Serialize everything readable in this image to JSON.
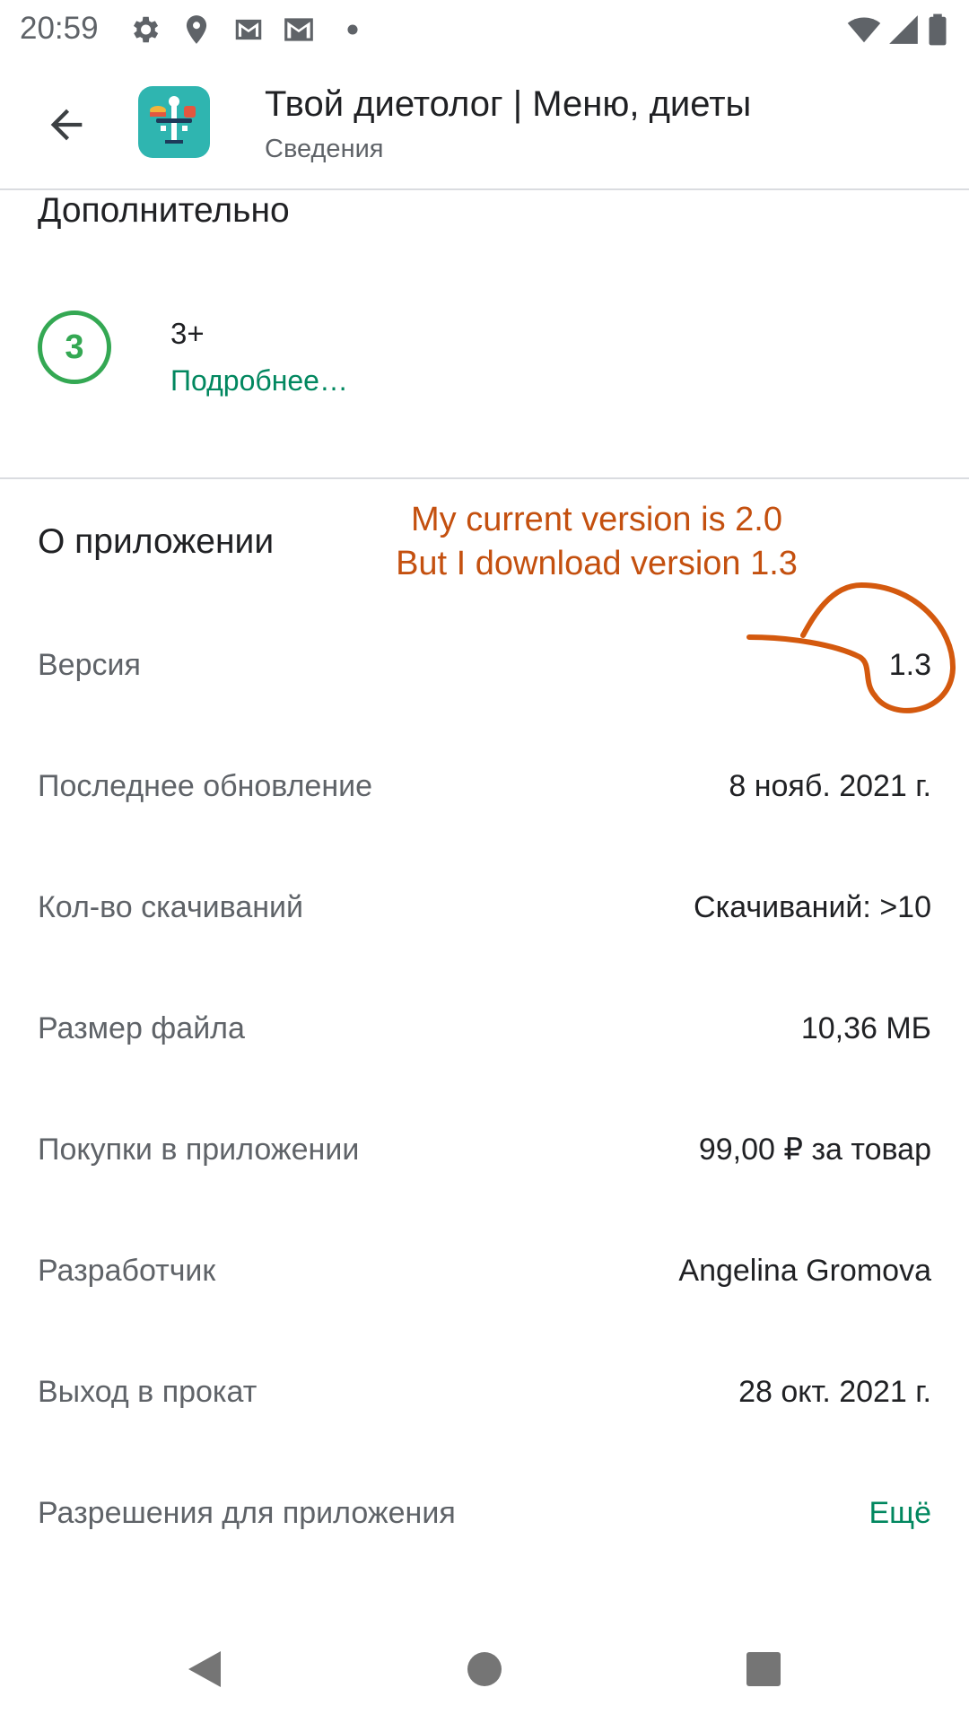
{
  "status_bar": {
    "time": "20:59",
    "icons": [
      "gear-icon",
      "location-icon",
      "gmail-icon",
      "gmail-icon",
      "dot-icon",
      "wifi-icon",
      "signal-icon",
      "battery-icon"
    ]
  },
  "header": {
    "title": "Твой диетолог | Меню, диеты",
    "subtitle": "Сведения",
    "back_icon": "arrow-back-icon",
    "app_icon": "scale-app-icon"
  },
  "additional": {
    "title": "Дополнительно",
    "rating_badge": "3",
    "rating_text": "3+",
    "rating_link": "Подробнее…"
  },
  "about": {
    "title": "О приложении",
    "rows": [
      {
        "label": "Версия",
        "value": "1.3"
      },
      {
        "label": "Последнее обновление",
        "value": "8 нояб. 2021 г."
      },
      {
        "label": "Кол-во скачиваний",
        "value": "Скачиваний: >10"
      },
      {
        "label": "Размер файла",
        "value": "10,36 МБ"
      },
      {
        "label": "Покупки в приложении",
        "value": "99,00 ₽ за товар"
      },
      {
        "label": "Разработчик",
        "value": "Angelina Gromova"
      },
      {
        "label": "Выход в прокат",
        "value": "28 окт. 2021 г."
      },
      {
        "label": "Разрешения для приложения",
        "value": "Ещё"
      }
    ]
  },
  "annotation": {
    "line1": "My current version is 2.0",
    "line2": "But I download version 1.3",
    "color": "#c4500f"
  },
  "nav_bar": {
    "icons": [
      "back-triangle-icon",
      "home-circle-icon",
      "recents-square-icon"
    ]
  },
  "colors": {
    "accent_green": "#01875f",
    "rating_green": "#34a853",
    "app_icon_bg": "#2fb5b0"
  }
}
